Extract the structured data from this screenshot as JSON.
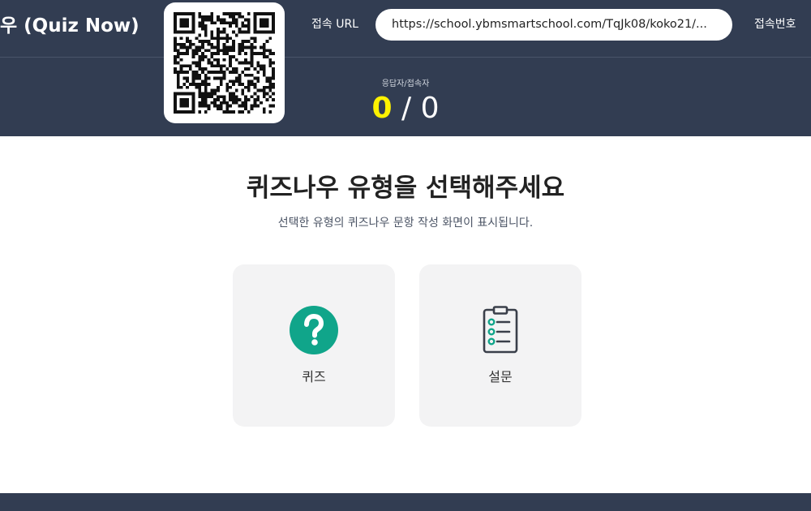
{
  "header": {
    "app_title": "우 (Quiz Now)",
    "url_label": "접속 URL",
    "url_value": "https://school.ybmsmartschool.com/TqJk08/koko21/...",
    "code_label": "접속번호",
    "counter_label": "응답자/접속자",
    "responded_count": "0",
    "separator": "/",
    "connected_count": "0"
  },
  "main": {
    "heading": "퀴즈나우 유형을 선택해주세요",
    "subheading": "선택한 유형의 퀴즈나우 문항 작성 화면이 표시됩니다.",
    "options": [
      {
        "label": "퀴즈",
        "icon": "question-circle-icon"
      },
      {
        "label": "설문",
        "icon": "clipboard-list-icon"
      }
    ]
  },
  "colors": {
    "header_bg": "#323d52",
    "accent_green": "#10a58a",
    "responded_yellow": "#fff200",
    "card_bg": "#f3f3f4"
  }
}
